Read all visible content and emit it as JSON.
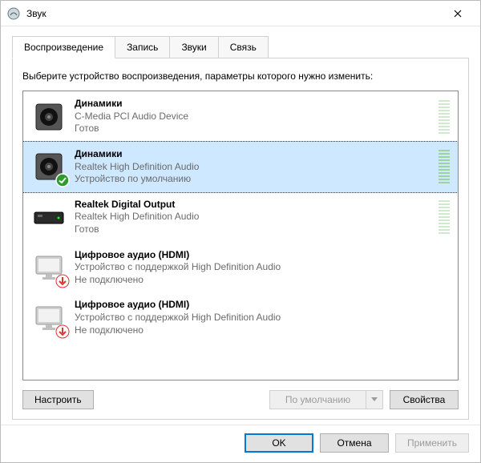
{
  "window": {
    "title": "Звук"
  },
  "tabs": {
    "playback": "Воспроизведение",
    "recording": "Запись",
    "sounds": "Звуки",
    "communications": "Связь"
  },
  "panel": {
    "instructions": "Выберите устройство воспроизведения, параметры которого нужно изменить:"
  },
  "devices": [
    {
      "name": "Динамики",
      "sub": "C-Media PCI Audio Device",
      "status": "Готов",
      "icon": "speaker",
      "badge": null,
      "selected": false,
      "vu": true
    },
    {
      "name": "Динамики",
      "sub": "Realtek High Definition Audio",
      "status": "Устройство по умолчанию",
      "icon": "speaker",
      "badge": "check",
      "selected": true,
      "vu": true
    },
    {
      "name": "Realtek Digital Output",
      "sub": "Realtek High Definition Audio",
      "status": "Готов",
      "icon": "digital-out",
      "badge": null,
      "selected": false,
      "vu": true
    },
    {
      "name": "Цифровое аудио (HDMI)",
      "sub": "Устройство с поддержкой High Definition Audio",
      "status": "Не подключено",
      "icon": "monitor",
      "badge": "down",
      "selected": false,
      "vu": false
    },
    {
      "name": "Цифровое аудио (HDMI)",
      "sub": "Устройство с поддержкой High Definition Audio",
      "status": "Не подключено",
      "icon": "monitor",
      "badge": "down",
      "selected": false,
      "vu": false
    }
  ],
  "buttons": {
    "configure": "Настроить",
    "set_default": "По умолчанию",
    "properties": "Свойства",
    "ok": "OK",
    "cancel": "Отмена",
    "apply": "Применить"
  },
  "state": {
    "set_default_enabled": false,
    "apply_enabled": false
  }
}
